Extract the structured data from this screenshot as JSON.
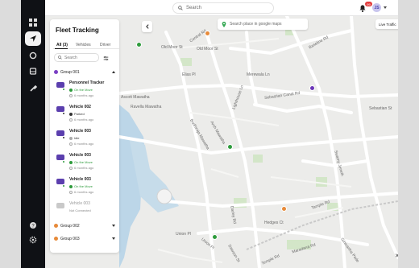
{
  "nav": {
    "items": [
      {
        "name": "dashboard-icon"
      },
      {
        "name": "navigation-icon"
      },
      {
        "name": "circle-icon"
      },
      {
        "name": "truck-icon"
      },
      {
        "name": "wrench-icon"
      },
      {
        "name": "help-icon"
      },
      {
        "name": "settings-icon"
      }
    ]
  },
  "topbar": {
    "search_label": "Search",
    "notification_count": "99",
    "avatar_initials": "JS"
  },
  "panel": {
    "title": "Fleet Tracking",
    "tabs": [
      {
        "label": "All (3)"
      },
      {
        "label": "Vehicles"
      },
      {
        "label": "Driver"
      }
    ],
    "search_placeholder": "Search",
    "groups": [
      {
        "label": "Group 001",
        "color": "#7b3fc4",
        "expanded": true
      },
      {
        "label": "Group 002",
        "color": "#e78a3a",
        "expanded": false
      },
      {
        "label": "Group 003",
        "color": "#e78a3a",
        "expanded": false
      }
    ],
    "vehicles": [
      {
        "name": "Personnel Tracker",
        "status": "On the Move",
        "status_color": "#2e9b3c",
        "time": "6 months ago",
        "icon_color": "#5b3fae"
      },
      {
        "name": "Vehicle 002",
        "status": "Parked",
        "status_color": "#333333",
        "time": "6 months ago",
        "icon_color": "#5b3fae"
      },
      {
        "name": "Vehicle 003",
        "status": "Idle",
        "status_color": "#333333",
        "time": "6 months ago",
        "icon_color": "#5b3fae"
      },
      {
        "name": "Vehicle 003",
        "status": "On the Move",
        "status_color": "#2e9b3c",
        "time": "6 months ago",
        "icon_color": "#5b3fae"
      },
      {
        "name": "Vehicle 003",
        "status": "On the Move",
        "status_color": "#2e9b3c",
        "time": "6 months ago",
        "icon_color": "#5b3fae"
      },
      {
        "name": "Vehicle 003",
        "status": "Not Connected",
        "status_color": "#888888",
        "time": "",
        "icon_color": "#c9c9c9"
      }
    ]
  },
  "map": {
    "search_placeholder": "Search place in google maps",
    "traffic_label": "Live Traffic",
    "traffic_on": true,
    "close_label": "✕",
    "zoom_in": "+",
    "zoom_out": "−",
    "street_labels": [
      "Central Rd",
      "Old Moor St",
      "Old Moor St",
      "Elias Pl",
      "Merewala Ln",
      "Lighthouse Ln",
      "Sebastian Canal Rd",
      "Sebastian St",
      "Baseline Rd",
      "Ascott Mawatha",
      "Ravella Mawatha",
      "Bodhiraja Mawatha",
      "Arch Mawatha",
      "Swamy Jeneth",
      "Hedges Ct",
      "Tample Rd",
      "Union Pl",
      "Union Pl",
      "Dawson St",
      "Darley Rd",
      "Ginivartha Pade",
      "Maradana Rd",
      "Temple Rd"
    ]
  }
}
